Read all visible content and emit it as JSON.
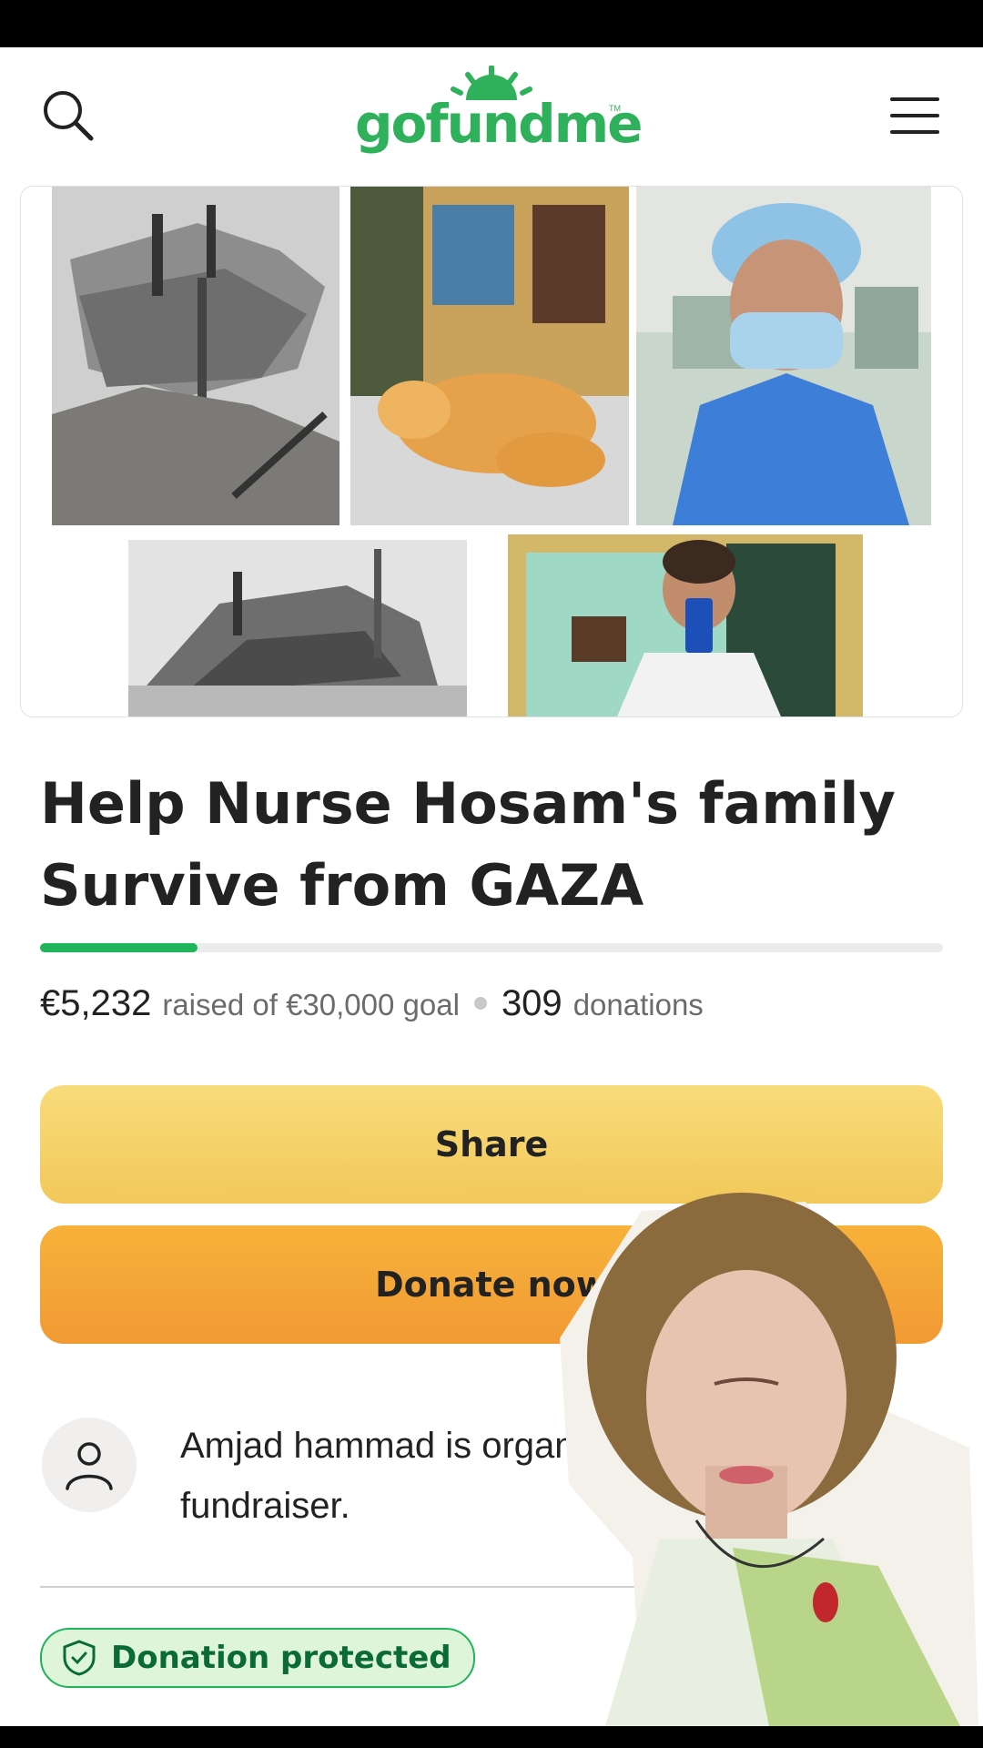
{
  "header": {
    "logo_text": "gofundme",
    "logo_tm": "TM"
  },
  "campaign": {
    "title": "Help Nurse Hosam's family Survive from GAZA",
    "progress_fraction": 0.1744
  },
  "stats": {
    "raised": "€5,232",
    "raised_suffix": "raised of €30,000 goal",
    "donation_count": "309",
    "donation_suffix": "donations"
  },
  "actions": {
    "share_label": "Share",
    "donate_label": "Donate now"
  },
  "organizer": {
    "text": "Amjad hammad is organ fundraiser."
  },
  "protection": {
    "badge_label": "Donation protected"
  },
  "colors": {
    "brand_green": "#2fb15b",
    "share_yellow": "#f5d26a",
    "donate_orange": "#f4a737"
  },
  "icons": [
    "search-icon",
    "menu-icon",
    "user-icon",
    "shield-icon"
  ]
}
